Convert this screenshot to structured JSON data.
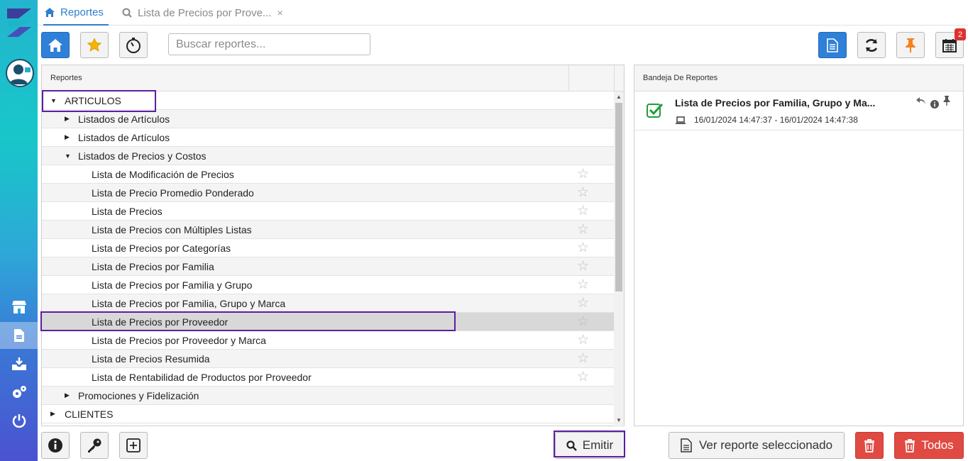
{
  "tabs": [
    {
      "label": "Reportes",
      "icon": "home-icon"
    },
    {
      "label": "Lista de Precios por Prove...",
      "icon": "search-icon",
      "close": "×"
    }
  ],
  "search": {
    "placeholder": "Buscar reportes..."
  },
  "notifications": {
    "calendar_badge": "2"
  },
  "reports_panel": {
    "header": "Reportes",
    "tree": [
      {
        "label": "ARTICULOS",
        "level": 0,
        "expanded": true
      },
      {
        "label": "Listados de Artículos",
        "level": 1,
        "expanded": false
      },
      {
        "label": "Listados de Artículos",
        "level": 1,
        "expanded": false
      },
      {
        "label": "Listados de Precios y Costos",
        "level": 1,
        "expanded": true
      },
      {
        "label": "Lista de Modificación de Precios",
        "level": 2
      },
      {
        "label": "Lista de Precio Promedio Ponderado",
        "level": 2
      },
      {
        "label": "Lista de Precios",
        "level": 2
      },
      {
        "label": "Lista de Precios con Múltiples Listas",
        "level": 2
      },
      {
        "label": "Lista de Precios por Categorías",
        "level": 2
      },
      {
        "label": "Lista de Precios por Familia",
        "level": 2
      },
      {
        "label": "Lista de Precios por Familia y Grupo",
        "level": 2
      },
      {
        "label": "Lista de Precios por Familia, Grupo y Marca",
        "level": 2
      },
      {
        "label": "Lista de Precios por Proveedor",
        "level": 2,
        "selected": true
      },
      {
        "label": "Lista de Precios por Proveedor y Marca",
        "level": 2
      },
      {
        "label": "Lista de Precios Resumida",
        "level": 2
      },
      {
        "label": "Lista de Rentabilidad de Productos por Proveedor",
        "level": 2
      },
      {
        "label": "Promociones y Fidelización",
        "level": 1,
        "expanded": false
      },
      {
        "label": "CLIENTES",
        "level": 0,
        "expanded": false
      }
    ]
  },
  "tray_panel": {
    "header": "Bandeja De Reportes",
    "jobs": [
      {
        "title": "Lista de Precios por Familia, Grupo y Ma...",
        "dates": "16/01/2024 14:47:37 - 16/01/2024 14:47:38",
        "status": "completed"
      }
    ]
  },
  "actions": {
    "emit": "Emitir",
    "view_selected": "Ver reporte seleccionado",
    "all": "Todos"
  },
  "colors": {
    "primary": "#2f80d8",
    "highlight": "#5a1fa3",
    "danger": "#e04a43",
    "pin": "#f58220",
    "success": "#1f9d3a"
  }
}
